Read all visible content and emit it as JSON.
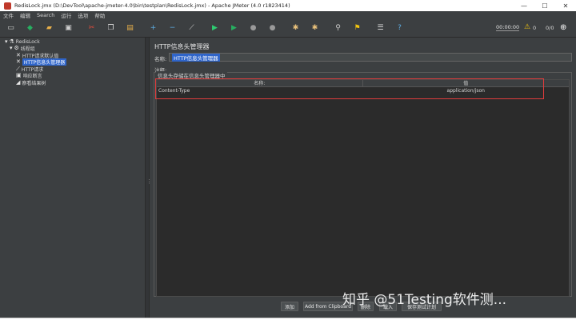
{
  "window": {
    "title": "RedisLock.jmx (D:\\DevTool\\apache-jmeter-4.0\\bin\\testplan\\RedisLock.jmx) - Apache JMeter (4.0 r1823414)",
    "controls": [
      "—",
      "☐",
      "✕"
    ]
  },
  "menu": [
    "文件",
    "编辑",
    "Search",
    "运行",
    "选项",
    "帮助"
  ],
  "toolbar": {
    "timer": "00:00:00",
    "warnings": "0",
    "threads": "0/0",
    "buttons": [
      {
        "name": "new-icon",
        "glyph": "▭",
        "color": "#d0d0d0"
      },
      {
        "name": "templates-icon",
        "glyph": "◆",
        "color": "#27ae60"
      },
      {
        "name": "open-icon",
        "glyph": "▰",
        "color": "#e8b04a"
      },
      {
        "name": "save-icon",
        "glyph": "▣",
        "color": "#d0d0d0"
      },
      {
        "name": "cut-icon",
        "glyph": "✂",
        "color": "#e74c3c"
      },
      {
        "name": "copy-icon",
        "glyph": "❐",
        "color": "#e0e0e0"
      },
      {
        "name": "paste-icon",
        "glyph": "▤",
        "color": "#e8b04a"
      },
      {
        "name": "expand-icon",
        "glyph": "+",
        "color": "#5dade2"
      },
      {
        "name": "collapse-icon",
        "glyph": "−",
        "color": "#5dade2"
      },
      {
        "name": "toggle-icon",
        "glyph": "⟋",
        "color": "#d0d0d0"
      },
      {
        "name": "start-icon",
        "glyph": "▶",
        "color": "#2ecc71"
      },
      {
        "name": "start-no-pause-icon",
        "glyph": "▶",
        "color": "#27ae60"
      },
      {
        "name": "stop-icon",
        "glyph": "●",
        "color": "#9a9a9a"
      },
      {
        "name": "shutdown-icon",
        "glyph": "●",
        "color": "#9a9a9a"
      },
      {
        "name": "clear-icon",
        "glyph": "✱",
        "color": "#e8c07a"
      },
      {
        "name": "clear-all-icon",
        "glyph": "✱",
        "color": "#e8c07a"
      },
      {
        "name": "search-icon",
        "glyph": "⚲",
        "color": "#d0d0d0"
      },
      {
        "name": "reset-search-icon",
        "glyph": "⚑",
        "color": "#f1c40f"
      },
      {
        "name": "function-helper-icon",
        "glyph": "☰",
        "color": "#e0e0e0"
      },
      {
        "name": "help-icon",
        "glyph": "?",
        "color": "#5dade2"
      }
    ]
  },
  "tree": {
    "root": "RedisLock",
    "thread_group": "线程组",
    "items": [
      "HTTP请求默认值",
      "HTTP信息头管理器",
      "HTTP请求",
      "响应断言",
      "察看结果树"
    ],
    "selected": "HTTP信息头管理器"
  },
  "panel": {
    "title": "HTTP信息头管理器",
    "name_label": "名称:",
    "name_value": "HTTP信息头管理器",
    "comment_label": "注释:",
    "group_title": "信息头存储在信息头管理器中",
    "columns": [
      "名称:",
      "值"
    ],
    "rows": [
      {
        "name": "Content-Type",
        "value": "application/json"
      }
    ]
  },
  "buttons": {
    "add": "添加",
    "add_clipboard": "Add from Clipboard",
    "delete": "删除",
    "load": "载入",
    "save_plan": "保存测试计划"
  },
  "watermark": "知乎 @51Testing软件测...",
  "colors": {
    "background": "#3c3f41",
    "selection": "#2f65ca",
    "highlight": "#e03c3c"
  }
}
